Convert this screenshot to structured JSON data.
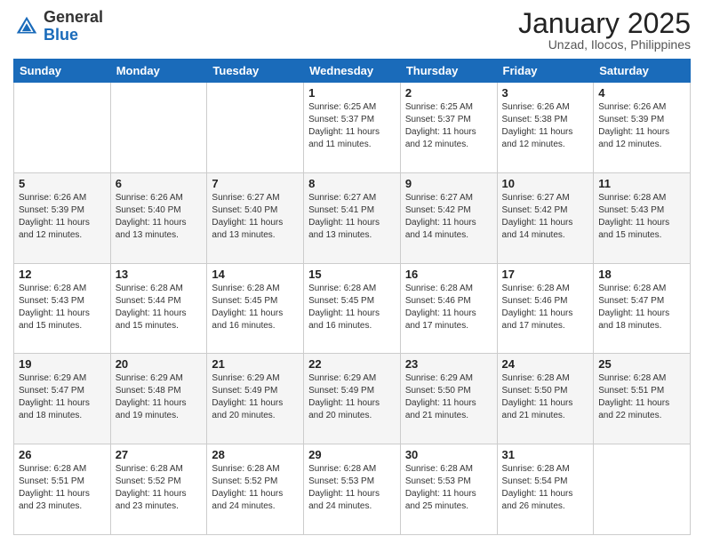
{
  "header": {
    "logo_general": "General",
    "logo_blue": "Blue",
    "month_title": "January 2025",
    "location": "Unzad, Ilocos, Philippines"
  },
  "days_of_week": [
    "Sunday",
    "Monday",
    "Tuesday",
    "Wednesday",
    "Thursday",
    "Friday",
    "Saturday"
  ],
  "weeks": [
    [
      {
        "day": "",
        "info": ""
      },
      {
        "day": "",
        "info": ""
      },
      {
        "day": "",
        "info": ""
      },
      {
        "day": "1",
        "info": "Sunrise: 6:25 AM\nSunset: 5:37 PM\nDaylight: 11 hours and 11 minutes."
      },
      {
        "day": "2",
        "info": "Sunrise: 6:25 AM\nSunset: 5:37 PM\nDaylight: 11 hours and 12 minutes."
      },
      {
        "day": "3",
        "info": "Sunrise: 6:26 AM\nSunset: 5:38 PM\nDaylight: 11 hours and 12 minutes."
      },
      {
        "day": "4",
        "info": "Sunrise: 6:26 AM\nSunset: 5:39 PM\nDaylight: 11 hours and 12 minutes."
      }
    ],
    [
      {
        "day": "5",
        "info": "Sunrise: 6:26 AM\nSunset: 5:39 PM\nDaylight: 11 hours and 12 minutes."
      },
      {
        "day": "6",
        "info": "Sunrise: 6:26 AM\nSunset: 5:40 PM\nDaylight: 11 hours and 13 minutes."
      },
      {
        "day": "7",
        "info": "Sunrise: 6:27 AM\nSunset: 5:40 PM\nDaylight: 11 hours and 13 minutes."
      },
      {
        "day": "8",
        "info": "Sunrise: 6:27 AM\nSunset: 5:41 PM\nDaylight: 11 hours and 13 minutes."
      },
      {
        "day": "9",
        "info": "Sunrise: 6:27 AM\nSunset: 5:42 PM\nDaylight: 11 hours and 14 minutes."
      },
      {
        "day": "10",
        "info": "Sunrise: 6:27 AM\nSunset: 5:42 PM\nDaylight: 11 hours and 14 minutes."
      },
      {
        "day": "11",
        "info": "Sunrise: 6:28 AM\nSunset: 5:43 PM\nDaylight: 11 hours and 15 minutes."
      }
    ],
    [
      {
        "day": "12",
        "info": "Sunrise: 6:28 AM\nSunset: 5:43 PM\nDaylight: 11 hours and 15 minutes."
      },
      {
        "day": "13",
        "info": "Sunrise: 6:28 AM\nSunset: 5:44 PM\nDaylight: 11 hours and 15 minutes."
      },
      {
        "day": "14",
        "info": "Sunrise: 6:28 AM\nSunset: 5:45 PM\nDaylight: 11 hours and 16 minutes."
      },
      {
        "day": "15",
        "info": "Sunrise: 6:28 AM\nSunset: 5:45 PM\nDaylight: 11 hours and 16 minutes."
      },
      {
        "day": "16",
        "info": "Sunrise: 6:28 AM\nSunset: 5:46 PM\nDaylight: 11 hours and 17 minutes."
      },
      {
        "day": "17",
        "info": "Sunrise: 6:28 AM\nSunset: 5:46 PM\nDaylight: 11 hours and 17 minutes."
      },
      {
        "day": "18",
        "info": "Sunrise: 6:28 AM\nSunset: 5:47 PM\nDaylight: 11 hours and 18 minutes."
      }
    ],
    [
      {
        "day": "19",
        "info": "Sunrise: 6:29 AM\nSunset: 5:47 PM\nDaylight: 11 hours and 18 minutes."
      },
      {
        "day": "20",
        "info": "Sunrise: 6:29 AM\nSunset: 5:48 PM\nDaylight: 11 hours and 19 minutes."
      },
      {
        "day": "21",
        "info": "Sunrise: 6:29 AM\nSunset: 5:49 PM\nDaylight: 11 hours and 20 minutes."
      },
      {
        "day": "22",
        "info": "Sunrise: 6:29 AM\nSunset: 5:49 PM\nDaylight: 11 hours and 20 minutes."
      },
      {
        "day": "23",
        "info": "Sunrise: 6:29 AM\nSunset: 5:50 PM\nDaylight: 11 hours and 21 minutes."
      },
      {
        "day": "24",
        "info": "Sunrise: 6:28 AM\nSunset: 5:50 PM\nDaylight: 11 hours and 21 minutes."
      },
      {
        "day": "25",
        "info": "Sunrise: 6:28 AM\nSunset: 5:51 PM\nDaylight: 11 hours and 22 minutes."
      }
    ],
    [
      {
        "day": "26",
        "info": "Sunrise: 6:28 AM\nSunset: 5:51 PM\nDaylight: 11 hours and 23 minutes."
      },
      {
        "day": "27",
        "info": "Sunrise: 6:28 AM\nSunset: 5:52 PM\nDaylight: 11 hours and 23 minutes."
      },
      {
        "day": "28",
        "info": "Sunrise: 6:28 AM\nSunset: 5:52 PM\nDaylight: 11 hours and 24 minutes."
      },
      {
        "day": "29",
        "info": "Sunrise: 6:28 AM\nSunset: 5:53 PM\nDaylight: 11 hours and 24 minutes."
      },
      {
        "day": "30",
        "info": "Sunrise: 6:28 AM\nSunset: 5:53 PM\nDaylight: 11 hours and 25 minutes."
      },
      {
        "day": "31",
        "info": "Sunrise: 6:28 AM\nSunset: 5:54 PM\nDaylight: 11 hours and 26 minutes."
      },
      {
        "day": "",
        "info": ""
      }
    ]
  ]
}
